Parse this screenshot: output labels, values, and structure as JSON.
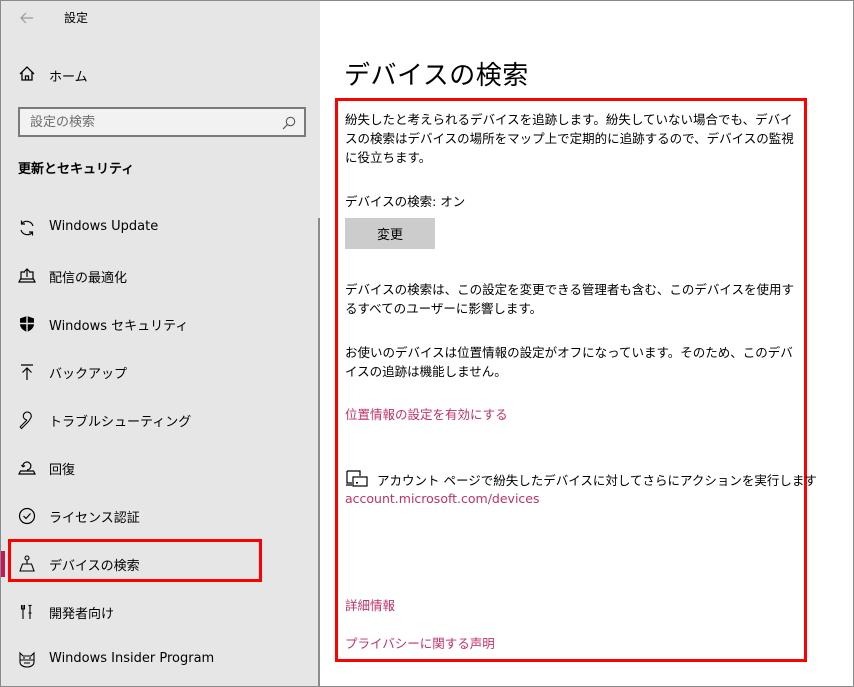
{
  "window": {
    "title": "設定",
    "back_icon": "back-arrow-icon"
  },
  "sidebar": {
    "home_label": "ホーム",
    "search_placeholder": "設定の検索",
    "section_title": "更新とセキュリティ",
    "items": [
      {
        "label": "Windows Update",
        "icon": "sync-icon",
        "selected": false
      },
      {
        "label": "配信の最適化",
        "icon": "delivery-optimization-icon",
        "selected": false
      },
      {
        "label": "Windows セキュリティ",
        "icon": "shield-icon",
        "selected": false
      },
      {
        "label": "バックアップ",
        "icon": "backup-arrow-icon",
        "selected": false
      },
      {
        "label": "トラブルシューティング",
        "icon": "wrench-icon",
        "selected": false
      },
      {
        "label": "回復",
        "icon": "recovery-icon",
        "selected": false
      },
      {
        "label": "ライセンス認証",
        "icon": "check-circle-icon",
        "selected": false
      },
      {
        "label": "デバイスの検索",
        "icon": "find-device-icon",
        "selected": true
      },
      {
        "label": "開発者向け",
        "icon": "developer-tools-icon",
        "selected": false
      },
      {
        "label": "Windows Insider Program",
        "icon": "insider-cat-icon",
        "selected": false
      }
    ]
  },
  "main": {
    "page_title": "デバイスの検索",
    "description": "紛失したと考えられるデバイスを追跡します。紛失していない場合でも、デバイスの検索はデバイスの場所をマップ上で定期的に追跡するので、デバイスの監視に役立ちます。",
    "status_label": "デバイスの検索: オン",
    "change_button": "変更",
    "admin_note": "デバイスの検索は、この設定を変更できる管理者も含む、このデバイスを使用するすべてのユーザーに影響します。",
    "location_off_note": "お使いのデバイスは位置情報の設定がオフになっています。そのため、このデバイスの追跡は機能しません。",
    "enable_location_link": "位置情報の設定を有効にする",
    "account_action_text": "アカウント ページで紛失したデバイスに対してさらにアクションを実行します",
    "account_link": "account.microsoft.com/devices",
    "more_info_link": "詳細情報",
    "privacy_link": "プライバシーに関する声明"
  },
  "colors": {
    "accent": "#c2185b",
    "link": "#c0306b",
    "highlight_box": "#ff0000",
    "sidebar_bg": "#e6e6e6",
    "button_bg": "#cccccc"
  }
}
